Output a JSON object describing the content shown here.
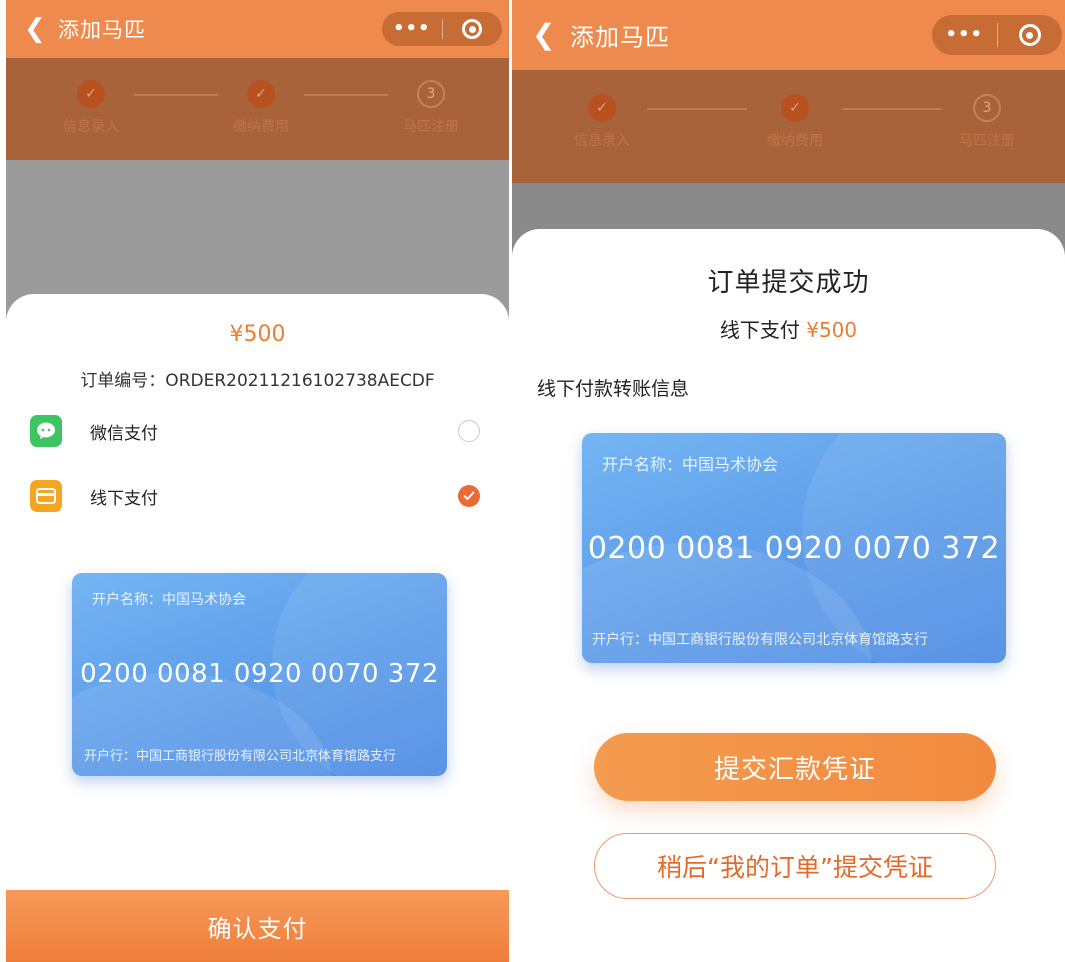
{
  "colors": {
    "accent": "#ee7d33",
    "nav_bar": "#ee8a4e",
    "card_blue": "#5d9ce9",
    "wechat_green": "#3ec561",
    "offline_yellow": "#f5a51f"
  },
  "left": {
    "nav": {
      "back_icon": "chevron-left",
      "title": "添加马匹",
      "more": "•••",
      "close_icon": "target-circle"
    },
    "steps": [
      {
        "label": "信息录入",
        "state": "done",
        "mark": "✓"
      },
      {
        "label": "缴纳费用",
        "state": "done",
        "mark": "✓"
      },
      {
        "label": "马匹注册",
        "state": "pending",
        "mark": "3"
      }
    ],
    "sheet": {
      "amount": "¥500",
      "order_number": "订单编号：ORDER20211216102738AECDF",
      "methods": [
        {
          "label": "微信支付",
          "icon": "wechat-icon",
          "selected": false
        },
        {
          "label": "线下支付",
          "icon": "wallet-icon",
          "selected": true
        }
      ],
      "card": {
        "account_name": "开户名称：中国马术协会",
        "number": "0200 0081 0920 0070 372",
        "bank": "开户行：中国工商银行股份有限公司北京体育馆路支行"
      },
      "confirm_label": "确认支付"
    }
  },
  "right": {
    "nav": {
      "back_icon": "chevron-left",
      "title": "添加马匹",
      "more": "•••",
      "close_icon": "target-circle"
    },
    "steps": [
      {
        "label": "信息录入",
        "state": "done",
        "mark": "✓"
      },
      {
        "label": "缴纳费用",
        "state": "done",
        "mark": "✓"
      },
      {
        "label": "马匹注册",
        "state": "pending",
        "mark": "3"
      }
    ],
    "sheet": {
      "title": "订单提交成功",
      "payment_label": "线下支付",
      "amount": "¥500",
      "transfer_title": "线下付款转账信息",
      "card": {
        "account_name": "开户名称：中国马术协会",
        "number": "0200 0081 0920 0070 372",
        "bank": "开户行：中国工商银行股份有限公司北京体育馆路支行"
      },
      "submit_button": "提交汇款凭证",
      "later_button": "稍后“我的订单”提交凭证"
    }
  }
}
